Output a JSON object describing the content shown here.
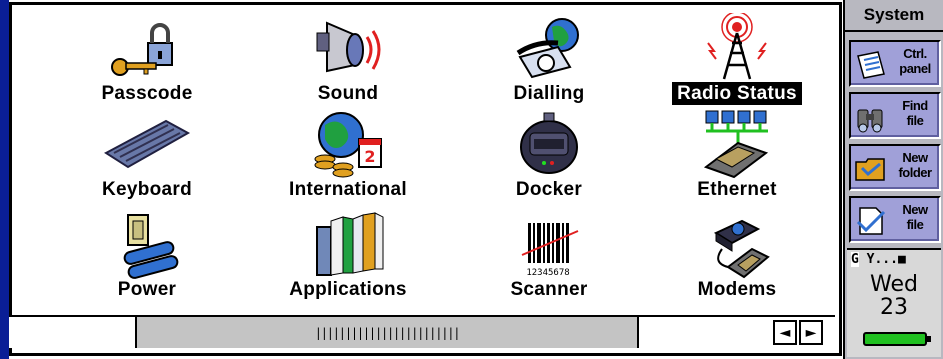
{
  "control_panel": {
    "items": [
      {
        "label": "Passcode",
        "icon": "padlock-key-icon"
      },
      {
        "label": "Sound",
        "icon": "speaker-icon"
      },
      {
        "label": "Dialling",
        "icon": "telephone-globe-icon"
      },
      {
        "label": "Radio Status",
        "icon": "radio-tower-icon",
        "selected": true
      },
      {
        "label": "Keyboard",
        "icon": "keyboard-icon"
      },
      {
        "label": "International",
        "icon": "globe-coins-calendar-icon"
      },
      {
        "label": "Docker",
        "icon": "docking-cradle-icon"
      },
      {
        "label": "Ethernet",
        "icon": "network-icon"
      },
      {
        "label": "Power",
        "icon": "battery-switch-icon"
      },
      {
        "label": "Applications",
        "icon": "books-icon"
      },
      {
        "label": "Scanner",
        "icon": "barcode-icon"
      },
      {
        "label": "Modems",
        "icon": "modem-phone-icon"
      }
    ],
    "barcode_number": "12345678",
    "calendar_digit": "2"
  },
  "scrollbar": {
    "thumb_grip": "||||||||||||||||||||||||",
    "left_arrow": "◄",
    "right_arrow": "►"
  },
  "toolbar": {
    "title": "System",
    "buttons": [
      {
        "line1": "Ctrl.",
        "line2": "panel",
        "icon": "control-panel-icon"
      },
      {
        "line1": "Find",
        "line2": "file",
        "icon": "binoculars-icon"
      },
      {
        "line1": "New",
        "line2": "folder",
        "icon": "folder-icon"
      },
      {
        "line1": "New",
        "line2": "file",
        "icon": "new-file-icon"
      }
    ]
  },
  "status": {
    "network": "G",
    "signal": "Y...■",
    "day": "Wed",
    "date": "23"
  },
  "colors": {
    "selection": "#000000",
    "toolbar_button": "#a0a0d8",
    "battery": "#20c020",
    "edge": "#0a1e96"
  }
}
